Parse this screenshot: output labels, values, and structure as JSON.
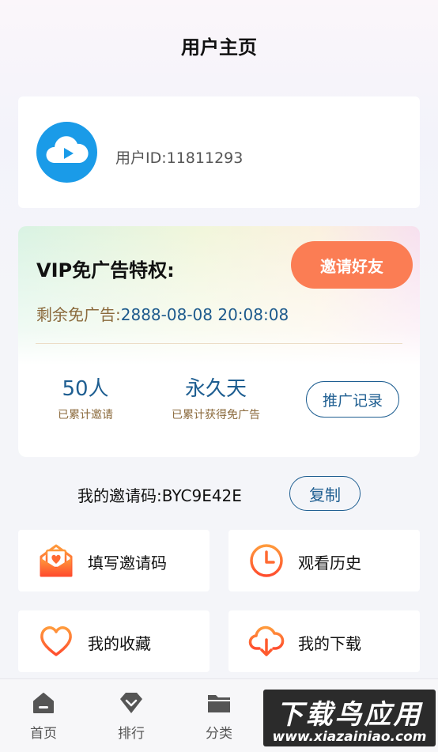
{
  "header": {
    "title": "用户主页"
  },
  "profile": {
    "user_id": "用户ID:11811293"
  },
  "vip": {
    "title": "VIP免广告特权:",
    "invite_button": "邀请好友",
    "remaining_label": "剩余免广告:",
    "remaining_value": "2888-08-08 20:08:08",
    "stats": [
      {
        "value": "50人",
        "label": "已累计邀请"
      },
      {
        "value": "永久天",
        "label": "已累计获得免广告"
      }
    ],
    "records_button": "推广记录"
  },
  "invite_code": {
    "label": "我的邀请码:",
    "code": "BYC9E42E",
    "copy_button": "复制"
  },
  "menu": [
    {
      "label": "填写邀请码",
      "icon": "envelope-heart-icon"
    },
    {
      "label": "观看历史",
      "icon": "clock-icon"
    },
    {
      "label": "我的收藏",
      "icon": "heart-icon"
    },
    {
      "label": "我的下载",
      "icon": "cloud-download-icon"
    }
  ],
  "tabbar": [
    {
      "label": "首页",
      "icon": "home-icon"
    },
    {
      "label": "排行",
      "icon": "diamond-icon"
    },
    {
      "label": "分类",
      "icon": "folder-icon"
    }
  ],
  "watermark": {
    "main": "下载鸟应用",
    "sub": "www.xiazainiao.com"
  },
  "colors": {
    "accent_orange": "#fb7d54",
    "accent_blue": "#1e5e91",
    "avatar_blue": "#1a9be8"
  }
}
